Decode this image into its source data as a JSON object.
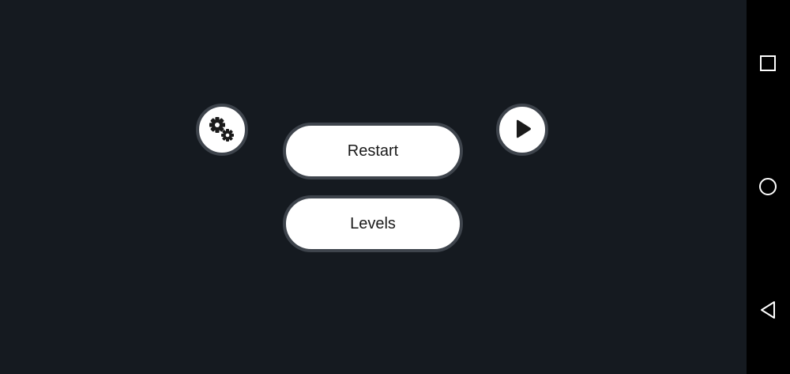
{
  "menu": {
    "restart_label": "Restart",
    "levels_label": "Levels",
    "settings_icon": "gears-icon",
    "play_icon": "play-icon"
  },
  "nav_bar": {
    "recents_icon": "square-icon",
    "home_icon": "circle-icon",
    "back_icon": "triangle-back-icon"
  },
  "colors": {
    "background": "#151a20",
    "button_fill": "#ffffff",
    "button_border": "#3e444c",
    "nav_background": "#000000"
  }
}
